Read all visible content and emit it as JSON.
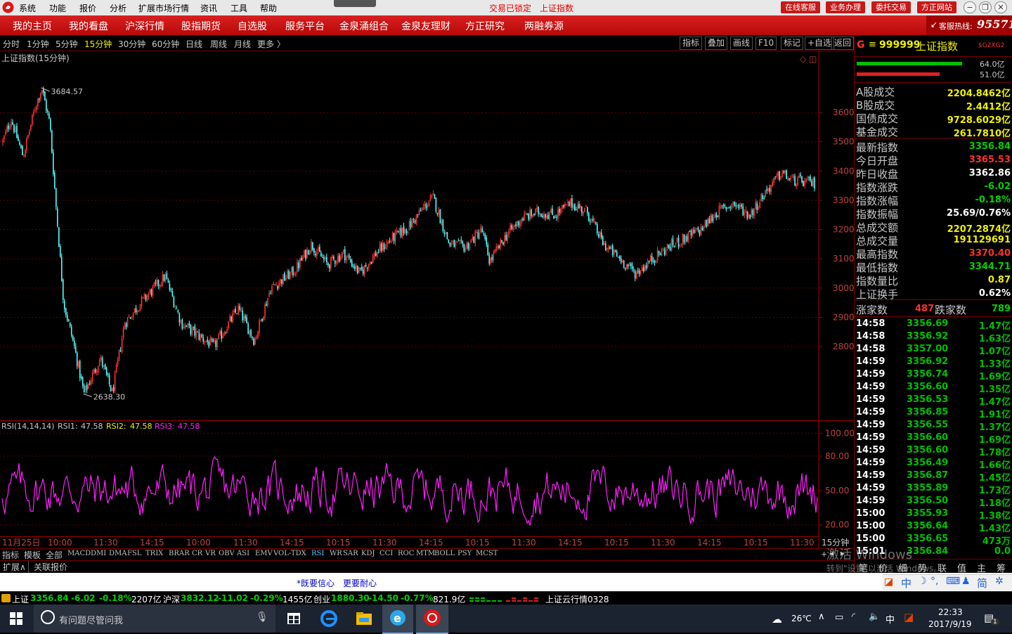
{
  "titlebar": {
    "menu": [
      "系统",
      "功能",
      "报价",
      "分析",
      "扩展市场行情",
      "资讯",
      "工具",
      "帮助"
    ],
    "center_left": "交易已锁定",
    "center_right": "上证指数",
    "buttons": [
      "在线客服",
      "业务办理",
      "委托交易",
      "方正网站"
    ]
  },
  "navbar": {
    "items": [
      "我的主页",
      "我的看盘",
      "沪深行情",
      "股指期货",
      "自选股",
      "服务平台",
      "金泉涌组合",
      "金泉友理财",
      "方正研究",
      "两融券源"
    ],
    "hotline_label": "客服热线:",
    "hotline_number": "95571"
  },
  "periodbar": {
    "periods": [
      "分时",
      "1分钟",
      "5分钟",
      "15分钟",
      "30分钟",
      "60分钟",
      "日线",
      "周线",
      "月线",
      "更多 〉"
    ],
    "active": "15分钟",
    "right_buttons": [
      "指标",
      "叠加",
      "画线",
      "F10",
      "标记",
      "+自选",
      "返回"
    ]
  },
  "main_chart": {
    "title": "上证指数(15分钟)",
    "high_label": "3684.57",
    "low_label": "2638.30"
  },
  "rsi_chart": {
    "label": "RSI(14,14,14)",
    "rsi1_label": "RSI1:",
    "rsi1": "47.58",
    "rsi2_label": "RSI2:",
    "rsi2": "47.58",
    "rsi3_label": "RSI3:",
    "rsi3": "47.58"
  },
  "time_axis": {
    "labels": [
      "11月25日",
      "10:00",
      "11:30",
      "14:15",
      "10:00",
      "11:30",
      "14:15",
      "10:15",
      "11:30",
      "14:15",
      "10:15",
      "11:30",
      "14:15",
      "10:15",
      "11:30",
      "14:15",
      "10:15",
      "11:30"
    ],
    "period": "15分钟"
  },
  "indicator_tabs": [
    "指标",
    "模板",
    "全部",
    "MACD",
    "DMI",
    "DMA",
    "FSL",
    "TRIX",
    "BRAR",
    "CR",
    "VR",
    "OBV",
    "ASI",
    "EMV",
    "VOL-TDX",
    "RSI",
    "WR",
    "SAR",
    "KDJ",
    "CCI",
    "ROC",
    "MTM",
    "BOLL",
    "PSY",
    "MCST"
  ],
  "active_indicator": "RSI",
  "ext_tabs": [
    "扩展∧",
    "关联报价"
  ],
  "info_links": [
    "*既要信心",
    "更要耐心"
  ],
  "right_panel": {
    "code": "999999",
    "name": "上证指数",
    "badge": "$G2XG2",
    "bar1_pct": "64.0亿",
    "bar2_pct": "51.0亿",
    "turnover": [
      {
        "label": "A股成交",
        "value": "2204.8462亿"
      },
      {
        "label": "B股成交",
        "value": "2.4412亿"
      },
      {
        "label": "国债成交",
        "value": "9728.6029亿"
      },
      {
        "label": "基金成交",
        "value": "261.7810亿"
      }
    ],
    "quote": [
      {
        "label": "最新指数",
        "value": "3356.84",
        "color": "green"
      },
      {
        "label": "今日开盘",
        "value": "3365.53",
        "color": "red"
      },
      {
        "label": "昨日收盘",
        "value": "3362.86",
        "color": "white"
      },
      {
        "label": "指数涨跌",
        "value": "-6.02",
        "color": "green"
      },
      {
        "label": "指数涨幅",
        "value": "-0.18%",
        "color": "green"
      },
      {
        "label": "指数振幅",
        "value": "25.69/0.76%",
        "color": "white"
      },
      {
        "label": "总成交额",
        "value": "2207.2874亿",
        "color": "yellow"
      },
      {
        "label": "总成交量",
        "value": "191129691",
        "color": "yellow"
      },
      {
        "label": "最高指数",
        "value": "3370.40",
        "color": "red"
      },
      {
        "label": "最低指数",
        "value": "3344.71",
        "color": "green"
      },
      {
        "label": "指数量比",
        "value": "0.87",
        "color": "yellow"
      },
      {
        "label": "上证换手",
        "value": "0.62%",
        "color": "white"
      }
    ],
    "up_label": "涨家数",
    "up_value": "487",
    "down_label": "跌家数",
    "down_value": "789",
    "ticks": [
      {
        "t": "14:58",
        "p": "3356.69",
        "v": "1.47亿"
      },
      {
        "t": "14:58",
        "p": "3356.92",
        "v": "1.63亿"
      },
      {
        "t": "14:58",
        "p": "3357.00",
        "v": "1.07亿"
      },
      {
        "t": "14:59",
        "p": "3356.92",
        "v": "1.33亿"
      },
      {
        "t": "14:59",
        "p": "3356.74",
        "v": "1.69亿"
      },
      {
        "t": "14:59",
        "p": "3356.60",
        "v": "1.35亿"
      },
      {
        "t": "14:59",
        "p": "3356.53",
        "v": "1.47亿"
      },
      {
        "t": "14:59",
        "p": "3356.85",
        "v": "1.91亿"
      },
      {
        "t": "14:59",
        "p": "3356.55",
        "v": "1.37亿"
      },
      {
        "t": "14:59",
        "p": "3356.60",
        "v": "1.69亿"
      },
      {
        "t": "14:59",
        "p": "3356.60",
        "v": "1.78亿"
      },
      {
        "t": "14:59",
        "p": "3356.49",
        "v": "1.66亿"
      },
      {
        "t": "14:59",
        "p": "3356.87",
        "v": "1.45亿"
      },
      {
        "t": "14:59",
        "p": "3355.89",
        "v": "1.73亿"
      },
      {
        "t": "14:59",
        "p": "3356.50",
        "v": "1.18亿"
      },
      {
        "t": "15:00",
        "p": "3355.93",
        "v": "1.38亿"
      },
      {
        "t": "15:00",
        "p": "3356.64",
        "v": "1.43亿"
      },
      {
        "t": "15:00",
        "p": "3356.65",
        "v": "473万"
      },
      {
        "t": "15:01",
        "p": "3356.84",
        "v": "0.0"
      }
    ],
    "bottom_tabs": [
      "笔",
      "价",
      "细",
      "势",
      "联",
      "值",
      "主",
      "筹"
    ]
  },
  "statusbar": {
    "sh_label": "上证",
    "sh_value": "3356.84",
    "sh_chg": "-6.02",
    "sh_pct": "-0.18%",
    "sh_amt": "2207亿",
    "hs_label": "沪深",
    "hs_value": "3832.12",
    "hs_chg": "-11.02",
    "hs_pct": "-0.29%",
    "hs_amt": "1455亿",
    "cy_label": "创业",
    "cy_value": "1880.30",
    "cy_chg": "-14.50",
    "cy_pct": "-0.77%",
    "cy_amt": "821.9亿",
    "cloud": "上证云行情0328"
  },
  "watermark": {
    "line1": "激活 Windows",
    "line2": "转到\"设置\"以激活 Windows。"
  },
  "ime": [
    "中",
    "简"
  ],
  "taskbar": {
    "search_placeholder": "有问题尽管问我",
    "weather": "26℃",
    "ime": "中",
    "time": "22:33",
    "date": "2017/9/19",
    "notify_count": "1"
  },
  "chart_data": [
    {
      "type": "candlestick",
      "title": "上证指数(15分钟)",
      "ylim": [
        2560,
        3790
      ],
      "yticks": [
        2800,
        2900,
        3000,
        3100,
        3200,
        3300,
        3400,
        3500,
        3600
      ],
      "price_path": [
        [
          0,
          3500
        ],
        [
          0.01,
          3580
        ],
        [
          0.025,
          3450
        ],
        [
          0.04,
          3620
        ],
        [
          0.048,
          3684.57
        ],
        [
          0.058,
          3560
        ],
        [
          0.065,
          3300
        ],
        [
          0.075,
          2950
        ],
        [
          0.088,
          2800
        ],
        [
          0.1,
          2638.3
        ],
        [
          0.12,
          2760
        ],
        [
          0.135,
          2640
        ],
        [
          0.15,
          2880
        ],
        [
          0.17,
          2950
        ],
        [
          0.2,
          3040
        ],
        [
          0.22,
          2880
        ],
        [
          0.24,
          2840
        ],
        [
          0.26,
          2800
        ],
        [
          0.29,
          2930
        ],
        [
          0.31,
          2820
        ],
        [
          0.33,
          3000
        ],
        [
          0.36,
          3060
        ],
        [
          0.38,
          3150
        ],
        [
          0.4,
          3080
        ],
        [
          0.42,
          3120
        ],
        [
          0.44,
          3050
        ],
        [
          0.46,
          3120
        ],
        [
          0.48,
          3170
        ],
        [
          0.5,
          3210
        ],
        [
          0.52,
          3280
        ],
        [
          0.53,
          3310
        ],
        [
          0.55,
          3150
        ],
        [
          0.57,
          3140
        ],
        [
          0.59,
          3200
        ],
        [
          0.6,
          3090
        ],
        [
          0.62,
          3180
        ],
        [
          0.64,
          3240
        ],
        [
          0.66,
          3260
        ],
        [
          0.68,
          3250
        ],
        [
          0.7,
          3290
        ],
        [
          0.72,
          3260
        ],
        [
          0.74,
          3150
        ],
        [
          0.76,
          3100
        ],
        [
          0.78,
          3050
        ],
        [
          0.8,
          3100
        ],
        [
          0.82,
          3140
        ],
        [
          0.84,
          3170
        ],
        [
          0.86,
          3200
        ],
        [
          0.88,
          3260
        ],
        [
          0.9,
          3290
        ],
        [
          0.92,
          3250
        ],
        [
          0.94,
          3330
        ],
        [
          0.96,
          3395
        ],
        [
          0.97,
          3370
        ],
        [
          1.0,
          3356.84
        ]
      ]
    },
    {
      "type": "line",
      "title": "RSI(14,14,14)",
      "ylim": [
        10,
        110
      ],
      "yticks": [
        20,
        50,
        80,
        100
      ],
      "series": [
        {
          "name": "RSI3",
          "value": 47.58
        }
      ]
    }
  ]
}
